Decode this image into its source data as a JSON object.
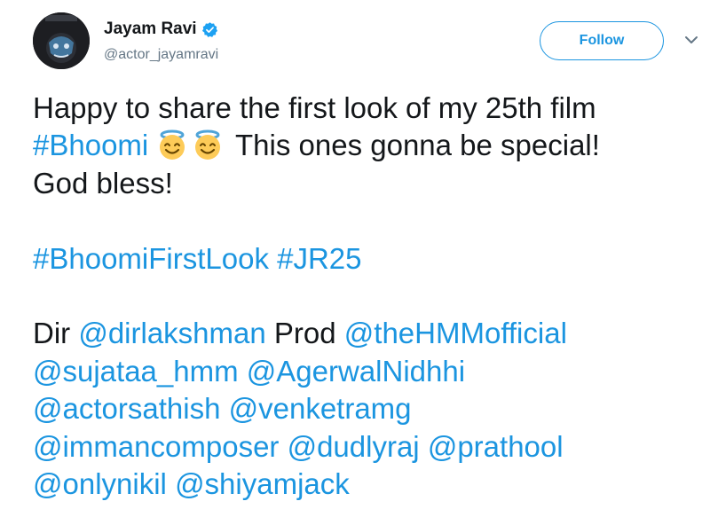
{
  "author": {
    "display_name": "Jayam Ravi",
    "handle": "@actor_jayamravi",
    "verified": true,
    "avatar_icon": "profile-avatar"
  },
  "actions": {
    "follow_label": "Follow",
    "menu_icon": "chevron-down-icon"
  },
  "colors": {
    "link": "#1b95e0",
    "text": "#14171a",
    "muted": "#657786"
  },
  "tweet": {
    "line1": "Happy to share the first look of my 25th film",
    "hashtag_bhoomi": "#Bhoomi",
    "emojis": "😇😇",
    "line2_rest": " This ones gonna be special!",
    "line3": "God bless!",
    "hashtag_firstlook": "#BhoomiFirstLook",
    "hashtag_jr25": "#JR25",
    "dir_label": "Dir ",
    "mention_dirlakshman": "@dirlakshman",
    "prod_label": " Prod ",
    "mention_thehmmofficial": "@theHMMofficial",
    "mention_sujataa": "@sujataa_hmm",
    "mention_agerwalnidhhi": "@AgerwalNidhhi",
    "mention_actorsathish": "@actorsathish",
    "mention_venketramg": "@venketramg",
    "mention_immancomposer": "@immancomposer",
    "mention_dudlyraj": "@dudlyraj",
    "mention_prathool": "@prathool",
    "mention_onlynikil": "@onlynikil",
    "mention_shiyamjack": "@shiyamjack"
  }
}
